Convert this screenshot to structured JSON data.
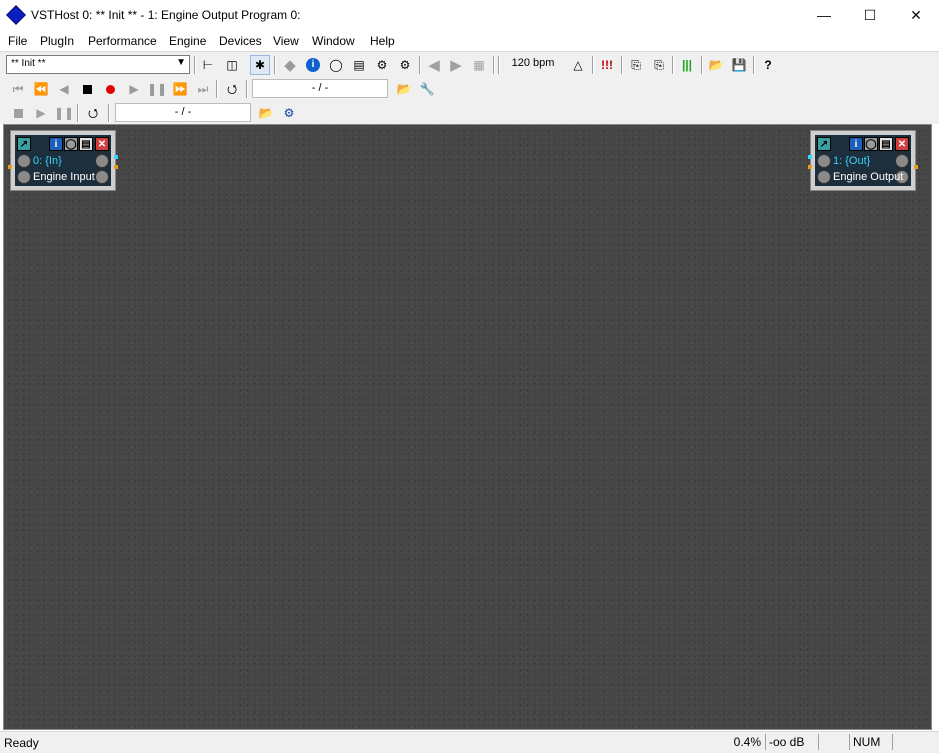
{
  "window": {
    "title": "VSTHost 0: ** Init ** - 1: Engine Output Program 0:"
  },
  "window_controls": {
    "minimize": "—",
    "maximize": "☐",
    "close": "✕"
  },
  "menu": [
    "File",
    "PlugIn",
    "Performance",
    "Engine",
    "Devices",
    "View",
    "Window",
    "Help"
  ],
  "toolbar": {
    "performance_combo": "** Init **",
    "tempo": "120 bpm",
    "player_position": "- / -",
    "recorder_position": "- / -"
  },
  "plugins": [
    {
      "index": "0: {In}",
      "name": "Engine Input"
    },
    {
      "index": "1: {Out}",
      "name": "Engine Output"
    }
  ],
  "status": {
    "text": "Ready",
    "cpu": "0.4%",
    "level": "-oo dB",
    "num": "NUM"
  },
  "colors": {
    "workspace": "#464646",
    "accent": "#0a1fbf",
    "record": "#e00000",
    "plugin_label": "#35d6ff"
  }
}
